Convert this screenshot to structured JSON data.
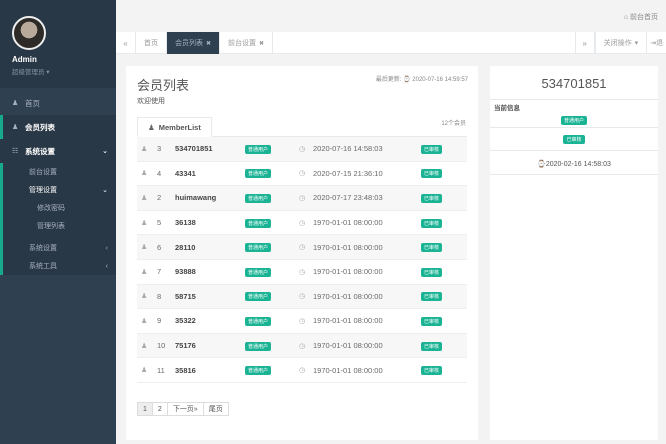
{
  "sidebar": {
    "user": {
      "name": "Admin",
      "role": "超级管理员 ▾"
    },
    "items": [
      {
        "label": "首页",
        "icon": "user-icon"
      },
      {
        "label": "会员列表",
        "icon": "user-icon"
      },
      {
        "label": "系统设置",
        "icon": "columns-icon"
      }
    ],
    "sub": {
      "front": "前台设置",
      "admin": "管理设置",
      "pwd": "修改密码",
      "list": "管理列表"
    },
    "more": [
      {
        "label": "系统设置"
      },
      {
        "label": "系统工具"
      }
    ]
  },
  "topbar": {
    "home": "前台首页"
  },
  "tabs": {
    "home": "首页",
    "members": "会员列表",
    "front": "前台设置",
    "close_ops": "关闭操作",
    "exit": "退"
  },
  "main": {
    "title": "会员列表",
    "welcome": "欢迎使用",
    "updated": "最后更新: ⌚ 2020-07-16 14:59:57",
    "tab": "MemberList",
    "count": "12个会员",
    "rows": [
      {
        "id": "3",
        "name": "534701851",
        "type": "普通用户",
        "date": "2020-07-16 14:58:03",
        "status": "已审核"
      },
      {
        "id": "4",
        "name": "43341",
        "type": "普通用户",
        "date": "2020-07-15 21:36:10",
        "status": "已审核"
      },
      {
        "id": "2",
        "name": "huimawang",
        "type": "普通用户",
        "date": "2020-07-17 23:48:03",
        "status": "已审核"
      },
      {
        "id": "5",
        "name": "36138",
        "type": "普通用户",
        "date": "1970-01-01 08:00:00",
        "status": "已审核"
      },
      {
        "id": "6",
        "name": "28110",
        "type": "普通用户",
        "date": "1970-01-01 08:00:00",
        "status": "已审核"
      },
      {
        "id": "7",
        "name": "93888",
        "type": "普通用户",
        "date": "1970-01-01 08:00:00",
        "status": "已审核"
      },
      {
        "id": "8",
        "name": "58715",
        "type": "普通用户",
        "date": "1970-01-01 08:00:00",
        "status": "已审核"
      },
      {
        "id": "9",
        "name": "35322",
        "type": "普通用户",
        "date": "1970-01-01 08:00:00",
        "status": "已审核"
      },
      {
        "id": "10",
        "name": "75176",
        "type": "普通用户",
        "date": "1970-01-01 08:00:00",
        "status": "已审核"
      },
      {
        "id": "11",
        "name": "35816",
        "type": "普通用户",
        "date": "1970-01-01 08:00:00",
        "status": "已审核"
      }
    ],
    "pager": [
      "1",
      "2",
      "下一页»",
      "尾页"
    ]
  },
  "detail": {
    "title": "534701851",
    "label": "当前信息",
    "type": "普通用户",
    "status": "已审核",
    "date": "⌚2020-02-16 14:58:03"
  },
  "colors": {
    "sidebar": "#2f4050",
    "accent": "#1ab394"
  }
}
